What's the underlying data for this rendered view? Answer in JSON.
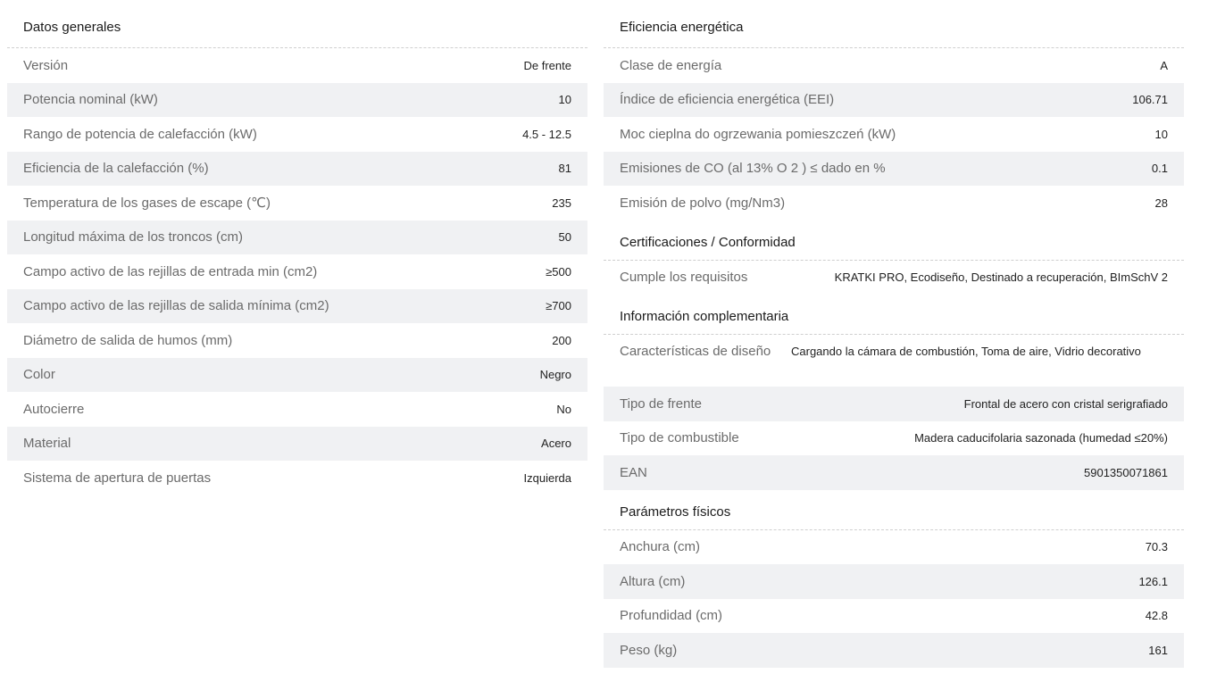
{
  "general": {
    "title": "Datos generales",
    "rows": [
      {
        "label": "Versión",
        "value": "De frente"
      },
      {
        "label": "Potencia nominal (kW)",
        "value": "10"
      },
      {
        "label": "Rango de potencia de calefacción (kW)",
        "value": "4.5 - 12.5"
      },
      {
        "label": "Eficiencia de la calefacción (%)",
        "value": "81"
      },
      {
        "label": "Temperatura de los gases de escape (℃)",
        "value": "235"
      },
      {
        "label": "Longitud máxima de los troncos (cm)",
        "value": "50"
      },
      {
        "label": "Campo activo de las rejillas de entrada min (cm2)",
        "value": "≥500"
      },
      {
        "label": "Campo activo de las rejillas de salida mínima (cm2)",
        "value": "≥700"
      },
      {
        "label": "Diámetro de salida de humos (mm)",
        "value": "200"
      },
      {
        "label": "Color",
        "value": "Negro"
      },
      {
        "label": "Autocierre",
        "value": "No"
      },
      {
        "label": "Material",
        "value": "Acero"
      },
      {
        "label": "Sistema de apertura de puertas",
        "value": "Izquierda"
      }
    ]
  },
  "efficiency": {
    "title": "Eficiencia energética",
    "rows": [
      {
        "label": "Clase de energía",
        "value": "A"
      },
      {
        "label": "Índice de eficiencia energética (EEI)",
        "value": "106.71"
      },
      {
        "label": "Moc cieplna do ogrzewania pomieszczeń (kW)",
        "value": "10"
      },
      {
        "label": "Emisiones de CO (al 13% O 2 ) ≤ dado en %",
        "value": "0.1"
      },
      {
        "label": "Emisión de polvo (mg/Nm3)",
        "value": "28"
      }
    ]
  },
  "certifications": {
    "title": "Certificaciones / Conformidad",
    "rows": [
      {
        "label": "Cumple los requisitos",
        "value": "KRATKI PRO, Ecodiseño, Destinado a recuperación, BImSchV 2"
      }
    ]
  },
  "complementary": {
    "title": "Información complementaria",
    "rows": [
      {
        "label": "Características de diseño",
        "value": "Cargando la cámara de combustión, Toma de aire, Vidrio decorativo"
      },
      {
        "label": "Tipo de frente",
        "value": "Frontal de acero con cristal serigrafiado"
      },
      {
        "label": "Tipo de combustible",
        "value": "Madera caducifolaria sazonada (humedad ≤20%)"
      },
      {
        "label": "EAN",
        "value": "5901350071861"
      }
    ]
  },
  "physical": {
    "title": "Parámetros físicos",
    "rows": [
      {
        "label": "Anchura (cm)",
        "value": "70.3"
      },
      {
        "label": "Altura (cm)",
        "value": "126.1"
      },
      {
        "label": "Profundidad (cm)",
        "value": "42.8"
      },
      {
        "label": "Peso (kg)",
        "value": "161"
      }
    ]
  }
}
